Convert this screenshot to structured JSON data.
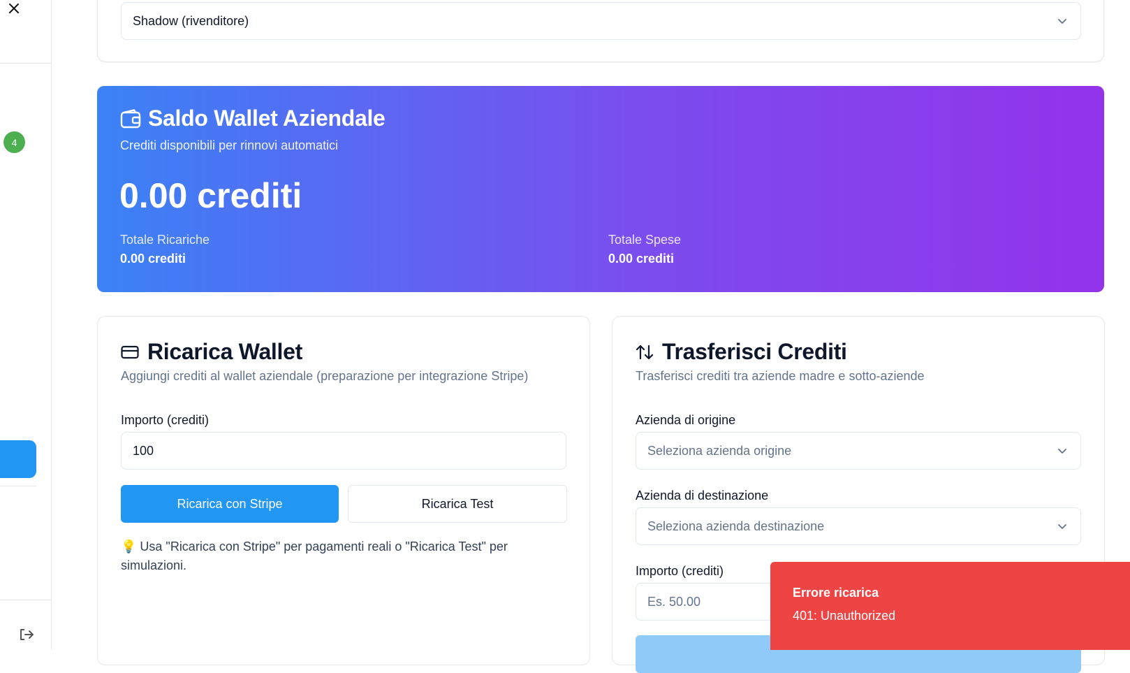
{
  "sidebar": {
    "badge_count": "4"
  },
  "company_select": {
    "value": "Shadow (rivenditore)"
  },
  "wallet": {
    "title": "Saldo Wallet Aziendale",
    "subtitle": "Crediti disponibili per rinnovi automatici",
    "balance": "0.00 crediti",
    "total_recharges_label": "Totale Ricariche",
    "total_recharges_value": "0.00 crediti",
    "total_expenses_label": "Totale Spese",
    "total_expenses_value": "0.00 crediti"
  },
  "recharge": {
    "title": "Ricarica Wallet",
    "description": "Aggiungi crediti al wallet aziendale (preparazione per integrazione Stripe)",
    "amount_label": "Importo (crediti)",
    "amount_value": "100",
    "stripe_button": "Ricarica con Stripe",
    "test_button": "Ricarica Test",
    "hint": "💡  Usa \"Ricarica con Stripe\" per pagamenti reali o \"Ricarica Test\" per simulazioni."
  },
  "transfer": {
    "title": "Trasferisci Crediti",
    "description": "Trasferisci crediti tra aziende madre e sotto-aziende",
    "origin_label": "Azienda di origine",
    "origin_placeholder": "Seleziona azienda origine",
    "destination_label": "Azienda di destinazione",
    "destination_placeholder": "Seleziona azienda destinazione",
    "amount_label": "Importo (crediti)",
    "amount_placeholder": "Es. 50.00"
  },
  "toast": {
    "title": "Errore ricarica",
    "message": "401: Unauthorized"
  },
  "colors": {
    "primary": "#2196f3",
    "gradient_start": "#3b82f6",
    "gradient_end": "#9333ea",
    "error": "#ef4444",
    "badge": "#4caf50"
  }
}
